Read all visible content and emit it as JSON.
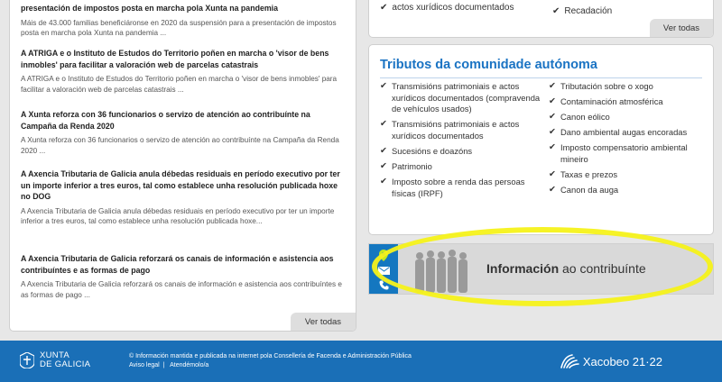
{
  "news": {
    "items": [
      {
        "title": "presentación de impostos posta en marcha pola Xunta na pandemia",
        "summary": "Máis de 43.000 familias beneficiáronse en 2020 da suspensión para a presentación de impostos posta en marcha pola Xunta na pandemia ..."
      },
      {
        "title": "A ATRIGA e o Instituto de Estudos do Territorio poñen en marcha o 'visor de bens inmobles' para facilitar a valoración web de parcelas catastrais",
        "summary": "A ATRIGA e o Instituto de Estudos do Territorio poñen en marcha o 'visor de bens inmobles' para facilitar a valoración web de parcelas catastrais ..."
      },
      {
        "title": "A Xunta reforza con 36 funcionarios o servizo de atención ao contribuínte na Campaña da Renda 2020",
        "summary": "A Xunta reforza con 36 funcionarios o servizo de atención ao contribuínte na Campaña da Renda 2020 ..."
      },
      {
        "title": "A Axencia Tributaria de Galicia anula débedas residuais en período executivo por ter un importe inferior a tres euros, tal como establece unha resolución publicada hoxe no DOG",
        "summary": "A Axencia Tributaria de Galicia anula débedas residuais en período executivo por ter un importe inferior a tres euros, tal como establece unha resolución publicada hoxe..."
      },
      {
        "title": "A Axencia Tributaria de Galicia reforzará os canais de información e asistencia aos contribuíntes e as formas de pago",
        "summary": "A Axencia Tributaria de Galicia reforzará os canais de información e asistencia aos contribuíntes e as formas de pago ..."
      }
    ],
    "see_all": "Ver todas"
  },
  "top_box": {
    "left_item": "actos xurídicos documentados",
    "right_item": "Recadación",
    "see_all": "Ver todas"
  },
  "tributos": {
    "title": "Tributos da comunidade autónoma",
    "left": [
      "Transmisións patrimoniais e actos xurídicos documentados (compravenda de vehículos usados)",
      "Transmisións patrimoniais e actos xurídicos documentados",
      "Sucesións e doazóns",
      "Patrimonio",
      "Imposto sobre a renda das persoas físicas (IRPF)"
    ],
    "right": [
      "Tributación sobre o xogo",
      "Contaminación atmosférica",
      "Canon eólico",
      "Dano ambiental augas encoradas",
      "Imposto compensatorio ambiental mineiro",
      "Taxas e prezos",
      "Canon da auga"
    ]
  },
  "banner": {
    "label_bold": "Información",
    "label_rest": " ao contribuínte"
  },
  "footer": {
    "logo_line1": "XUNTA",
    "logo_line2": "DE GALICIA",
    "info": "© Información mantida e publicada na internet pola Consellería de Facenda e Administración Pública",
    "link_legal": "Aviso legal",
    "separator": "|",
    "link_contact": "Atendémolo/a",
    "xacobeo": "Xacobeo 21·22"
  },
  "icons": {
    "check": "✔",
    "pin": "location-pin-icon",
    "mail": "envelope-icon",
    "phone": "phone-icon"
  },
  "colors": {
    "accent": "#1a73c3",
    "footer": "#1a6fb7",
    "highlight": "#f6f21a"
  }
}
